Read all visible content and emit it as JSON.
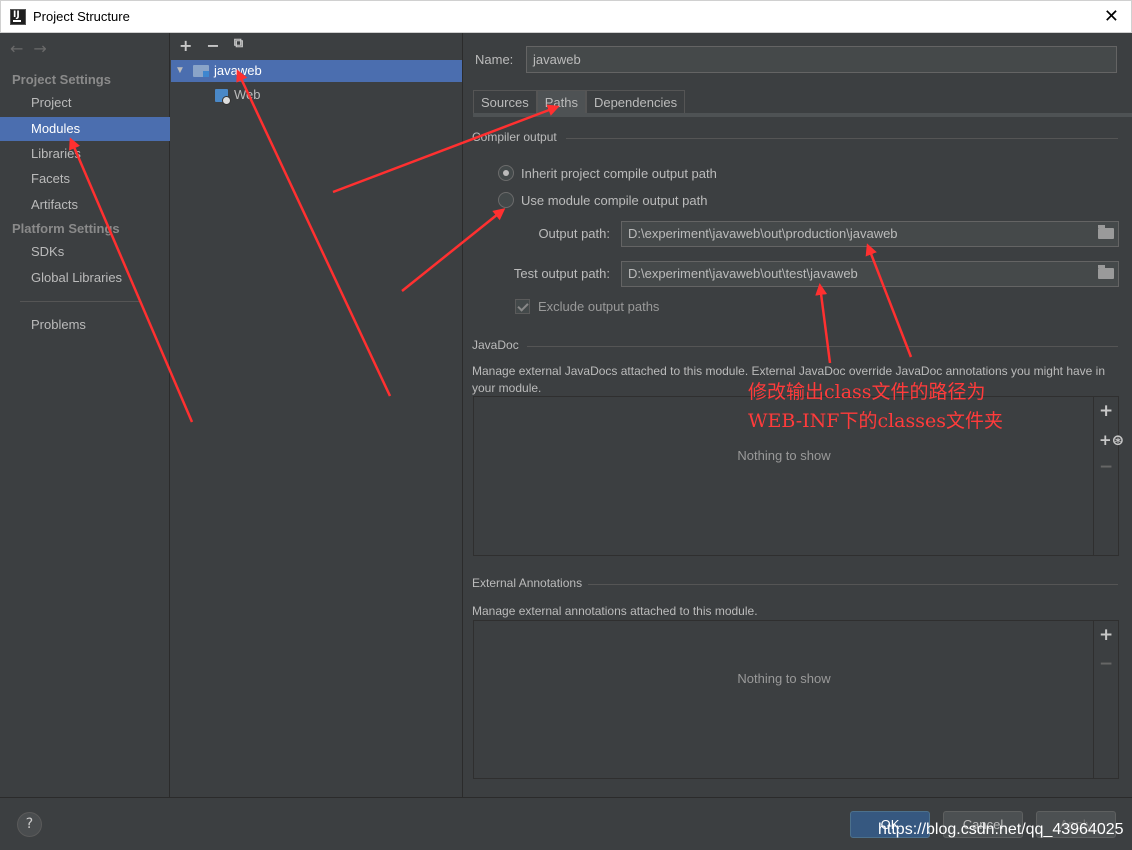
{
  "window": {
    "title": "Project Structure"
  },
  "sidebar": {
    "project_settings": "Project Settings",
    "platform_settings": "Platform Settings",
    "items": [
      {
        "label": "Project"
      },
      {
        "label": "Modules"
      },
      {
        "label": "Libraries"
      },
      {
        "label": "Facets"
      },
      {
        "label": "Artifacts"
      },
      {
        "label": "SDKs"
      },
      {
        "label": "Global Libraries"
      },
      {
        "label": "Problems"
      }
    ]
  },
  "tree": {
    "module": "javaweb",
    "child": "Web"
  },
  "content": {
    "name_label": "Name:",
    "name_value": "javaweb",
    "tabs": [
      "Sources",
      "Paths",
      "Dependencies"
    ],
    "compiler_output": "Compiler output",
    "inherit_label": "Inherit project compile output path",
    "use_module_label": "Use module compile output path",
    "output_label": "Output path:",
    "output_value": "D:\\experiment\\javaweb\\out\\production\\javaweb",
    "test_output_label": "Test output path:",
    "test_output_value": "D:\\experiment\\javaweb\\out\\test\\javaweb",
    "exclude_label": "Exclude output paths",
    "javadoc_title": "JavaDoc",
    "javadoc_desc": "Manage external JavaDocs attached to this module. External JavaDoc override JavaDoc annotations you might have in your module.",
    "ext_title": "External Annotations",
    "ext_desc": "Manage external annotations attached to this module.",
    "empty_text": "Nothing to show"
  },
  "annotation": {
    "line1": "修改输出class文件的路径为",
    "line2": "WEB-INF下的classes文件夹",
    "color": "#ff3b3b"
  },
  "footer": {
    "help": "?",
    "ok": "OK",
    "cancel": "Cancel",
    "apply": "Apply",
    "watermark": "https://blog.csdn.net/qq_43964025"
  },
  "colors": {
    "selection": "#4b6eaf",
    "background": "#3c3f41",
    "primary_button": "#365880"
  }
}
